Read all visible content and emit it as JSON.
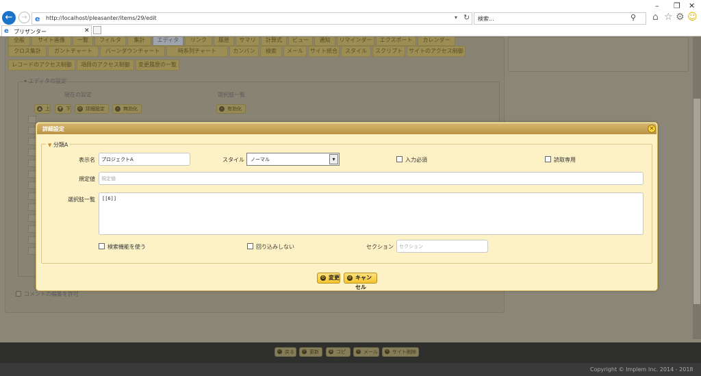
{
  "browser": {
    "url": "http://localhost/pleasanter/items/29/edit",
    "search_placeholder": "検索...",
    "tab_title": "プリザンター",
    "back_icon": "arrow-left-icon",
    "forward_icon": "arrow-right-icon"
  },
  "background": {
    "tabs_row1": [
      "全般",
      "サイト画像",
      "一覧",
      "フィルタ",
      "集計",
      "エディタ",
      "リンク",
      "履歴",
      "サマリ",
      "計算式",
      "ビュー",
      "通知",
      "リマインダー",
      "エクスポート",
      "カレンダー"
    ],
    "tabs_row2": [
      "クロス集計",
      "ガントチャート",
      "バーンダウンチャート",
      "時系列チャート",
      "カンバン",
      "検索",
      "メール",
      "サイト統合",
      "スタイル",
      "スクリプト",
      "サイトのアクセス制御"
    ],
    "tabs_row3": [
      "レコードのアクセス制御",
      "項目のアクセス制御",
      "変更履歴の一覧"
    ],
    "active_tab": "エディタ",
    "editor_legend": "エディタの設定",
    "current_settings": "現在の設定",
    "choices_list": "選択肢一覧",
    "btn_up": "上",
    "btn_down": "下",
    "btn_detail": "詳細設定",
    "btn_disable": "無効化",
    "btn_enable": "有効化",
    "comment_edit_label": "コメントの編集を許可",
    "footer_buttons": [
      "戻る",
      "更新",
      "コピー",
      "メール",
      "サイト削除"
    ],
    "copyright": "Copyright © Implem Inc. 2014 - 2018"
  },
  "dialog": {
    "title": "詳細設定",
    "section": "分類A",
    "display_name_label": "表示名",
    "display_name_value": "プロジェクトA",
    "style_label": "スタイル",
    "style_value": "ノーマル",
    "required_label": "入力必須",
    "readonly_label": "読取専用",
    "default_label": "規定値",
    "default_placeholder": "規定値",
    "choices_label": "選択肢一覧",
    "choices_value": "[[6]]",
    "search_feature_label": "検索機能を使う",
    "no_wrap_label": "回り込みしない",
    "section_label": "セクション",
    "section_placeholder": "セクション",
    "change_button": "変更",
    "cancel_button": "キャンセル"
  }
}
